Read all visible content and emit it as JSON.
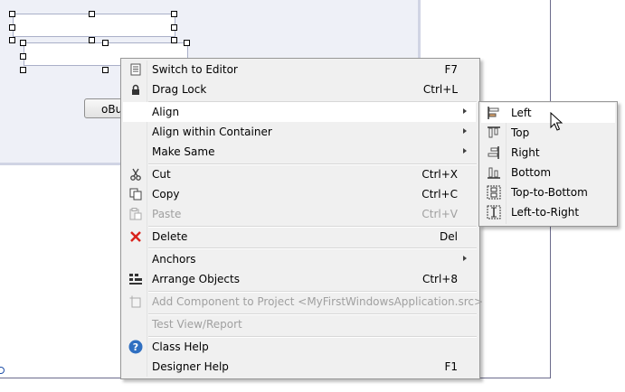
{
  "designer": {
    "button_label": "oBu"
  },
  "menu": {
    "items": [
      {
        "label": "Switch to Editor",
        "shortcut": "F7",
        "icon": "editor-page-icon"
      },
      {
        "label": "Drag Lock",
        "shortcut": "Ctrl+L",
        "icon": "lock-icon"
      },
      {
        "label": "Align",
        "submenu": true
      },
      {
        "label": "Align within Container",
        "submenu": true
      },
      {
        "label": "Make Same",
        "submenu": true
      },
      {
        "label": "Cut",
        "shortcut": "Ctrl+X",
        "icon": "scissors-icon"
      },
      {
        "label": "Copy",
        "shortcut": "Ctrl+C",
        "icon": "copy-icon"
      },
      {
        "label": "Paste",
        "shortcut": "Ctrl+V",
        "icon": "paste-icon",
        "disabled": true
      },
      {
        "label": "Delete",
        "shortcut": "Del",
        "icon": "delete-x-icon"
      },
      {
        "label": "Anchors",
        "submenu": true
      },
      {
        "label": "Arrange Objects",
        "shortcut": "Ctrl+8",
        "icon": "arrange-objects-icon"
      },
      {
        "label": "Add Component to Project <MyFirstWindowsApplication.src>",
        "icon": "add-component-icon",
        "disabled": true
      },
      {
        "label": "Test View/Report",
        "disabled": true
      },
      {
        "label": "Class Help",
        "icon": "help-icon"
      },
      {
        "label": "Designer Help",
        "shortcut": "F1"
      }
    ]
  },
  "submenu": {
    "items": [
      {
        "label": "Left",
        "icon": "align-left-icon"
      },
      {
        "label": "Top",
        "icon": "align-top-icon"
      },
      {
        "label": "Right",
        "icon": "align-right-icon"
      },
      {
        "label": "Bottom",
        "icon": "align-bottom-icon"
      },
      {
        "label": "Top-to-Bottom",
        "icon": "top-to-bottom-icon"
      },
      {
        "label": "Left-to-Right",
        "icon": "left-to-right-icon"
      }
    ]
  },
  "colors": {
    "menu_bg": "#f0f0f0",
    "highlight": "#ffffff",
    "disabled_text": "#a0a0a0",
    "delete_red": "#d9231c",
    "help_blue": "#2f6fc1"
  }
}
